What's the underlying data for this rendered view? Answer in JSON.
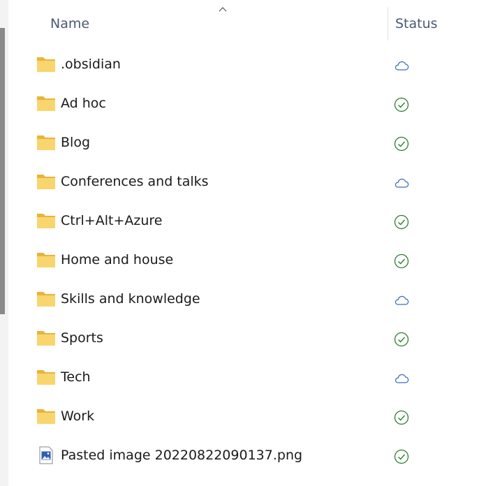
{
  "header": {
    "name_label": "Name",
    "status_label": "Status",
    "sort_icon": "chevron-up-icon"
  },
  "items": [
    {
      "label": ".obsidian",
      "type": "folder",
      "status": "cloud"
    },
    {
      "label": "Ad hoc",
      "type": "folder",
      "status": "synced"
    },
    {
      "label": "Blog",
      "type": "folder",
      "status": "synced"
    },
    {
      "label": "Conferences and talks",
      "type": "folder",
      "status": "cloud"
    },
    {
      "label": "Ctrl+Alt+Azure",
      "type": "folder",
      "status": "synced"
    },
    {
      "label": "Home and house",
      "type": "folder",
      "status": "synced"
    },
    {
      "label": "Skills and knowledge",
      "type": "folder",
      "status": "cloud"
    },
    {
      "label": "Sports",
      "type": "folder",
      "status": "synced"
    },
    {
      "label": "Tech",
      "type": "folder",
      "status": "cloud"
    },
    {
      "label": "Work",
      "type": "folder",
      "status": "synced"
    },
    {
      "label": "Pasted image 20220822090137.png",
      "type": "image-file",
      "status": "synced"
    }
  ],
  "colors": {
    "cloud": "#3b6fb6",
    "synced": "#2e7d32",
    "folder_front": "#f9d56e",
    "folder_back": "#e8b43c"
  }
}
